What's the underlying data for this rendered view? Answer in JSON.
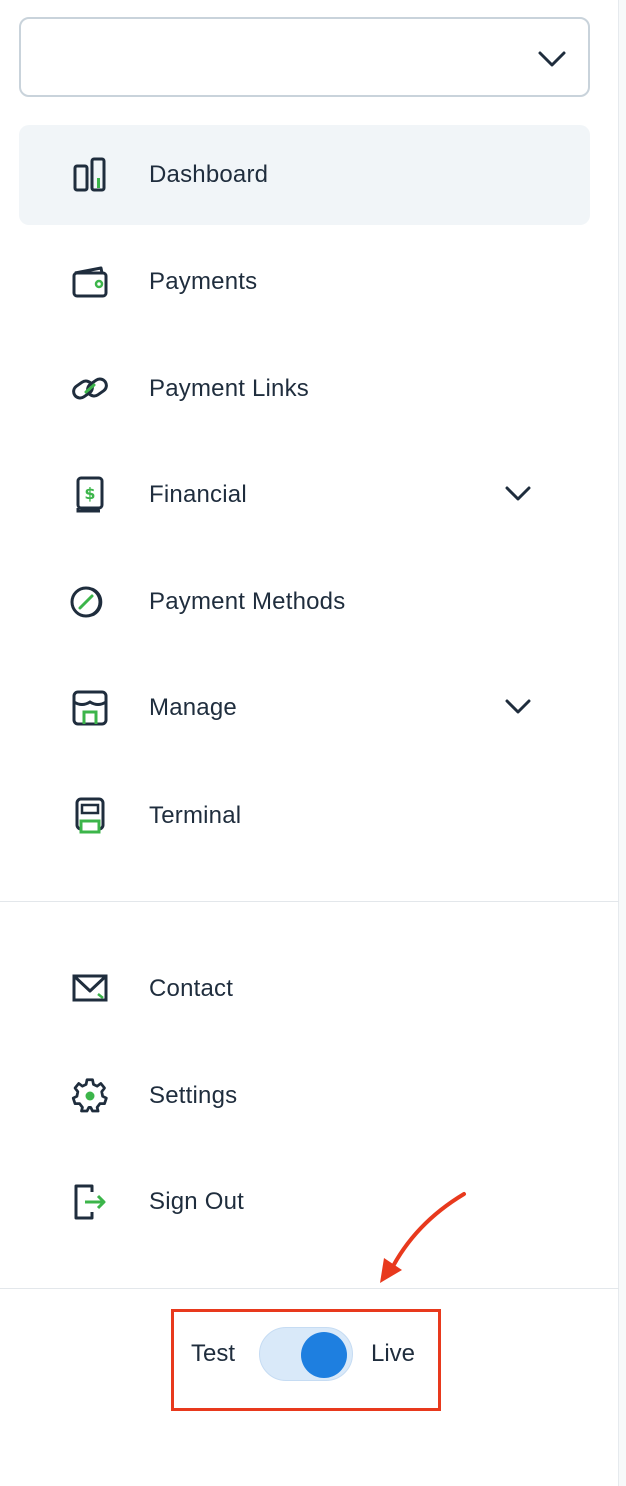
{
  "account_selector": {
    "value": ""
  },
  "nav": {
    "primary": [
      {
        "label": "Dashboard",
        "icon": "bar-chart-icon",
        "active": true
      },
      {
        "label": "Payments",
        "icon": "wallet-icon"
      },
      {
        "label": "Payment Links",
        "icon": "link-icon"
      },
      {
        "label": "Financial",
        "icon": "dollar-document-icon",
        "expandable": true
      },
      {
        "label": "Payment Methods",
        "icon": "card-circle-icon"
      },
      {
        "label": "Manage",
        "icon": "storefront-icon",
        "expandable": true
      },
      {
        "label": "Terminal",
        "icon": "terminal-icon"
      }
    ],
    "secondary": [
      {
        "label": "Contact",
        "icon": "mail-icon"
      },
      {
        "label": "Settings",
        "icon": "gear-icon"
      },
      {
        "label": "Sign Out",
        "icon": "sign-out-icon"
      }
    ]
  },
  "mode_toggle": {
    "left_label": "Test",
    "right_label": "Live",
    "state": "Live",
    "on": true
  },
  "colors": {
    "text": "#1f2d3d",
    "accent_green": "#3cb54a",
    "active_bg": "#f1f5f8",
    "toggle_knob": "#1e7fe0",
    "toggle_track": "#d9e9f9",
    "annotation_red": "#e8391d"
  }
}
